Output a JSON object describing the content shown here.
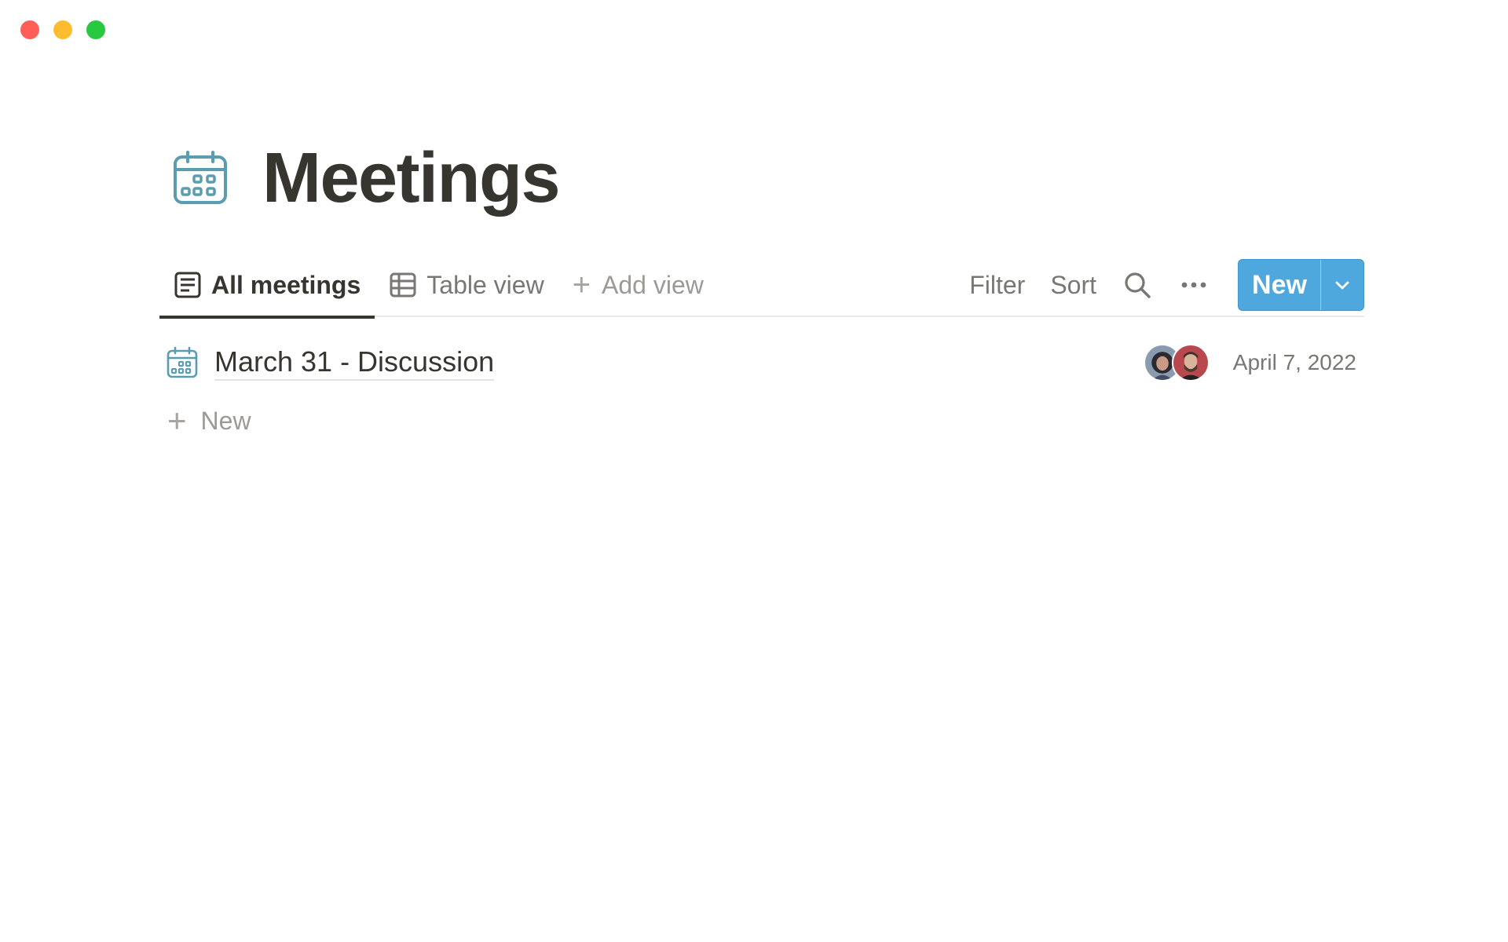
{
  "window": {
    "traffic_lights": [
      "close",
      "minimize",
      "maximize"
    ]
  },
  "page": {
    "title": "Meetings",
    "icon": "calendar-icon"
  },
  "views": {
    "tabs": [
      {
        "label": "All meetings",
        "icon": "list-page-icon",
        "active": true
      },
      {
        "label": "Table view",
        "icon": "table-icon",
        "active": false
      }
    ],
    "add_view_label": "Add view"
  },
  "toolbar": {
    "filter_label": "Filter",
    "sort_label": "Sort",
    "search_icon": "search-icon",
    "more_icon": "more-icon",
    "new_label": "New"
  },
  "rows": [
    {
      "title": "March 31 - Discussion",
      "date": "April 7, 2022",
      "avatars": 2
    }
  ],
  "add_row_label": "New",
  "colors": {
    "accent": "#4ea8de",
    "text": "#37352f",
    "muted": "#787774",
    "icon_teal": "#5a9db0"
  }
}
